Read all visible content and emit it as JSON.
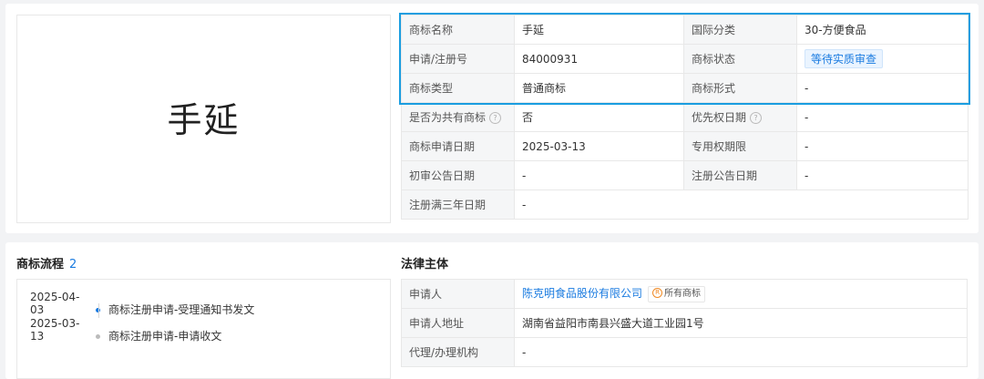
{
  "trademark_image": {
    "text": "手延"
  },
  "info": {
    "rows": [
      {
        "l1": "商标名称",
        "v1": "手延",
        "l2": "国际分类",
        "v2": "30-方便食品"
      },
      {
        "l1": "申请/注册号",
        "v1": "84000931",
        "l2": "商标状态",
        "v2": "等待实质审查"
      },
      {
        "l1": "商标类型",
        "v1": "普通商标",
        "l2": "商标形式",
        "v2": "-"
      },
      {
        "l1": "是否为共有商标",
        "v1": "否",
        "l2": "优先权日期",
        "v2": "-"
      },
      {
        "l1": "商标申请日期",
        "v1": "2025-03-13",
        "l2": "专用权期限",
        "v2": "-"
      },
      {
        "l1": "初审公告日期",
        "v1": "-",
        "l2": "注册公告日期",
        "v2": "-"
      },
      {
        "l1": "注册满三年日期",
        "v1": "-"
      }
    ],
    "help_glyph": "?"
  },
  "process": {
    "title": "商标流程",
    "count": "2",
    "items": [
      {
        "date": "2025-04-03",
        "text": "商标注册申请-受理通知书发文"
      },
      {
        "date": "2025-03-13",
        "text": "商标注册申请-申请收文"
      }
    ]
  },
  "legal": {
    "title": "法律主体",
    "applicant_label": "申请人",
    "applicant": "陈克明食品股份有限公司",
    "all_marks_glyph": "R",
    "all_marks": "所有商标",
    "address_label": "申请人地址",
    "address": "湖南省益阳市南县兴盛大道工业园1号",
    "agency_label": "代理/办理机构",
    "agency": "-"
  },
  "colors": {
    "accent": "#1a7be0",
    "highlight_border": "#1a9de0",
    "label_bg": "#f5f6f7",
    "page_bg": "#f2f3f5"
  }
}
